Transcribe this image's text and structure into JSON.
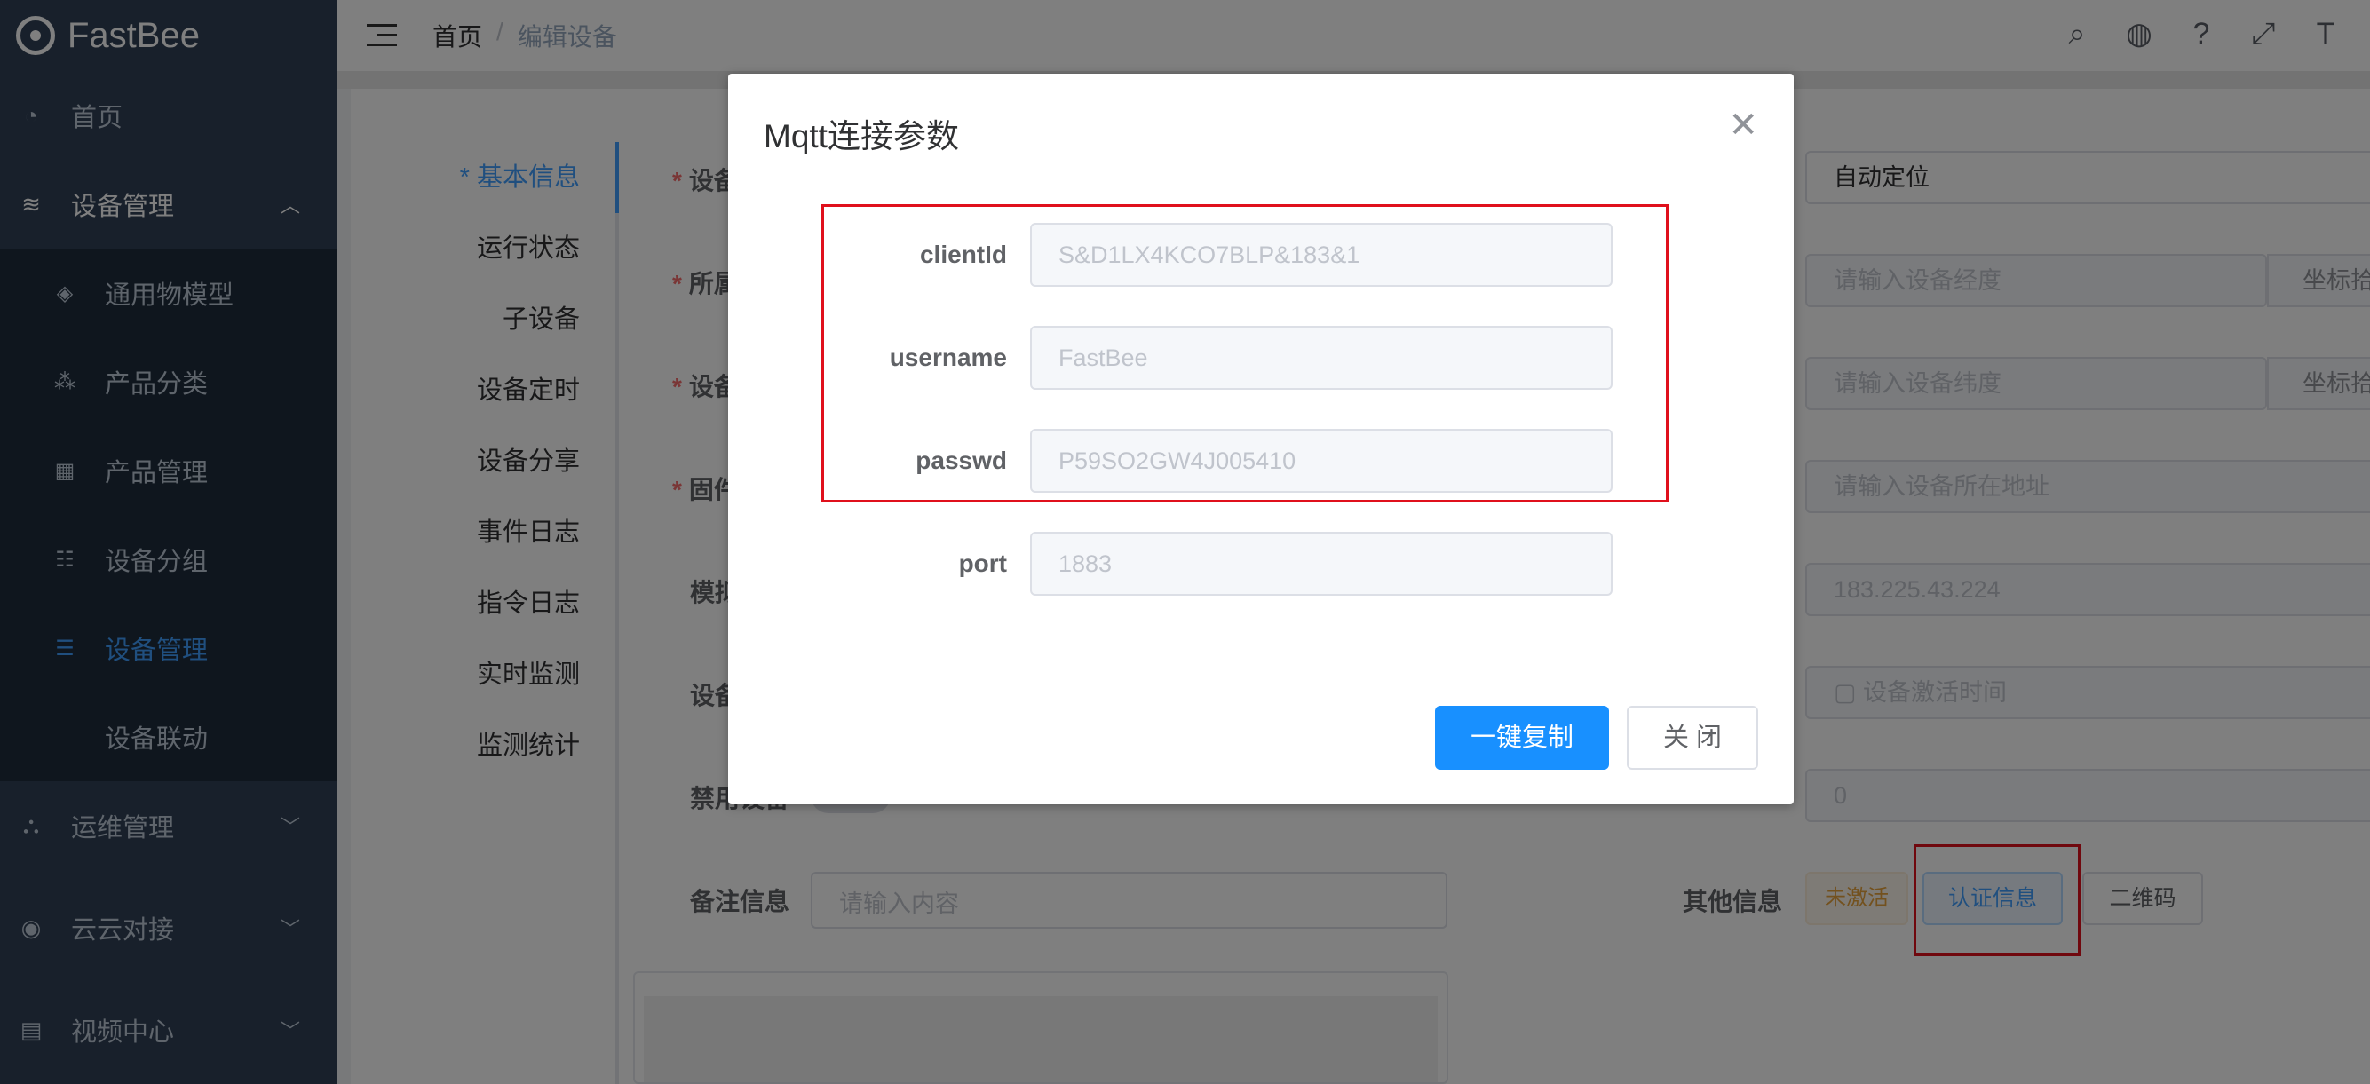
{
  "app": {
    "name": "FastBee"
  },
  "sidebar": {
    "items": [
      {
        "label": "首页",
        "icon": "dashboard-icon"
      },
      {
        "label": "设备管理",
        "icon": "layers-icon",
        "expanded": true,
        "children": [
          {
            "label": "通用物模型",
            "icon": "cube-icon"
          },
          {
            "label": "产品分类",
            "icon": "tree-icon"
          },
          {
            "label": "产品管理",
            "icon": "grid-icon"
          },
          {
            "label": "设备分组",
            "icon": "group-icon"
          },
          {
            "label": "设备管理",
            "icon": "list-icon",
            "active": true
          },
          {
            "label": "设备联动",
            "icon": ""
          }
        ]
      },
      {
        "label": "运维管理",
        "icon": "sitemap-icon"
      },
      {
        "label": "云云对接",
        "icon": "eye-icon"
      },
      {
        "label": "视频中心",
        "icon": "table-icon"
      }
    ]
  },
  "header": {
    "breadcrumb": [
      "首页",
      "编辑设备"
    ],
    "icons": [
      "search-icon",
      "github-icon",
      "help-icon",
      "fullscreen-icon",
      "font-size-icon"
    ]
  },
  "tabs": [
    "* 基本信息",
    "运行状态",
    "子设备",
    "设备定时",
    "设备分享",
    "事件日志",
    "指令日志",
    "实时监测",
    "监测统计"
  ],
  "form": {
    "left_labels": [
      "设备",
      "所属",
      "设备",
      "固件",
      "模拟",
      "设备",
      "禁用设备",
      "备注信息"
    ],
    "remark_placeholder": "请输入内容",
    "location_mode": "自动定位",
    "longitude_placeholder": "请输入设备经度",
    "latitude_placeholder": "请输入设备纬度",
    "coord_pick": "坐标拾",
    "address_placeholder": "请输入设备所在地址",
    "ip": "183.225.43.224",
    "activation_placeholder": "设备激活时间",
    "signal": "0",
    "other_info_label": "其他信息",
    "status_tag": "未激活",
    "auth_button": "认证信息",
    "qrcode_button": "二维码"
  },
  "dialog": {
    "title": "Mqtt连接参数",
    "fields": [
      {
        "label": "clientId",
        "value": "S&D1LX4KCO7BLP&183&1"
      },
      {
        "label": "username",
        "value": "FastBee"
      },
      {
        "label": "passwd",
        "value": "P59SO2GW4J005410"
      },
      {
        "label": "port",
        "value": "1883"
      }
    ],
    "copy_button": "一键复制",
    "close_button": "关 闭"
  },
  "colors": {
    "primary": "#1890ff",
    "sidebar_bg": "#304156",
    "highlight": "#e0101c"
  }
}
